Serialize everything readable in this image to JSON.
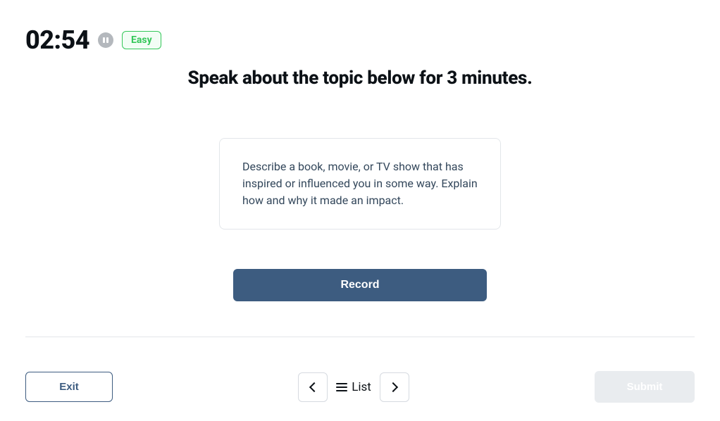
{
  "header": {
    "timer": "02:54",
    "difficulty": "Easy"
  },
  "main": {
    "instruction": "Speak about the topic below for 3 minutes.",
    "prompt": "Describe a book, movie, or TV show that has inspired or influenced you in some way. Explain how and why it made an impact.",
    "record_label": "Record"
  },
  "footer": {
    "exit_label": "Exit",
    "list_label": "List",
    "submit_label": "Submit"
  }
}
